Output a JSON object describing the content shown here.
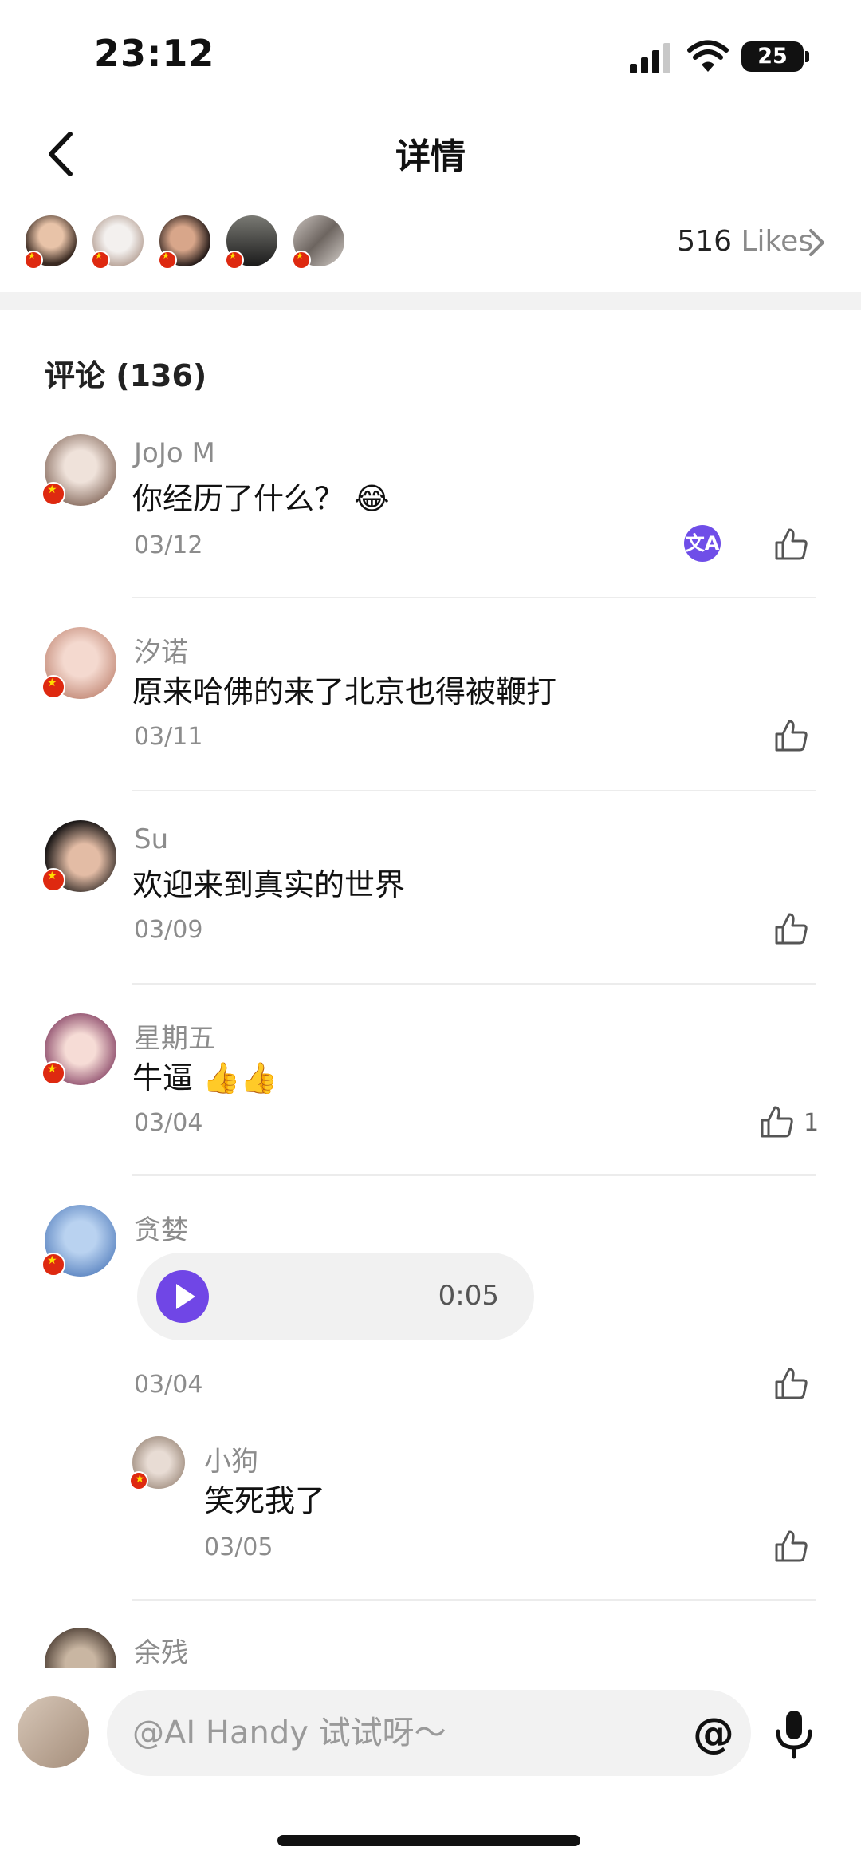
{
  "status_bar": {
    "time": "23:12",
    "battery": "25"
  },
  "header": {
    "title": "详情"
  },
  "likers": {
    "count": "516",
    "label": "Likes"
  },
  "comments_title": "评论 (136)",
  "comments": [
    {
      "name": "JoJo M",
      "text": "你经历了什么？",
      "emoji": "😂",
      "date": "03/12"
    },
    {
      "name": "汐诺",
      "text": "原来哈佛的来了北京也得被鞭打",
      "date": "03/11"
    },
    {
      "name": "Su",
      "text": "欢迎来到真实的世界",
      "date": "03/09"
    },
    {
      "name": "星期五",
      "text": "牛逼",
      "emoji": "👍👍",
      "date": "03/04",
      "like_count": "1"
    },
    {
      "name": "贪婪",
      "voice_duration": "0:05",
      "date": "03/04"
    },
    {
      "name": "小狗",
      "text": "笑死我了",
      "date": "03/05"
    },
    {
      "name": "余残"
    }
  ],
  "translate_icon_text": "文A",
  "input": {
    "placeholder": "@AI Handy 试试呀～",
    "at_symbol": "@"
  },
  "colors": {
    "accent": "#7046e6",
    "flag": "#de2910"
  }
}
